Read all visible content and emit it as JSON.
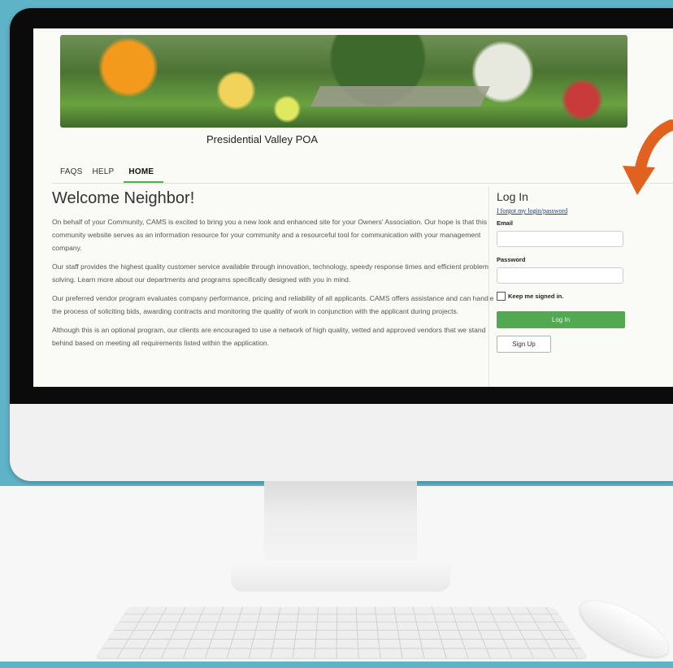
{
  "site": {
    "title": "Presidential Valley POA"
  },
  "nav": {
    "items": [
      "FAQS",
      "HELP",
      "HOME"
    ],
    "active": "HOME"
  },
  "main": {
    "heading": "Welcome Neighbor!",
    "paragraphs": [
      "On behalf of your Community, CAMS is excited to bring you a new look and enhanced site for your Owners' Association. Our hope is that this community website serves as an information resource for your community and a resourceful tool for communication with your management company.",
      "Our staff provides the highest quality customer service available through innovation, technology, speedy response times and efficient problem solving. Learn more about our departments and programs specifically designed with you in mind.",
      "Our preferred vendor program evaluates company performance, pricing and reliability of all applicants. CAMS offers assistance and can handle the process of soliciting bids, awarding contracts and monitoring the quality of work in conjunction with the applicant during projects.",
      "Although this is an optional program, our clients are encouraged to use a network of high quality, vetted and approved vendors that we stand behind based on meeting all requirements listed within the application."
    ]
  },
  "login": {
    "heading": "Log In",
    "forgot_link": "I forgot my login/password",
    "email_label": "Email",
    "email_value": "",
    "password_label": "Password",
    "password_value": "",
    "keep_signed_in": "Keep me signed in.",
    "keep_checked": false,
    "login_button": "Log In",
    "signup_button": "Sign Up"
  },
  "colors": {
    "background": "#5fb3c7",
    "accent_green": "#53a852",
    "arrow": "#e0621e",
    "link": "#1f3e7a"
  },
  "icons": {
    "pointer": "curved-arrow-icon"
  }
}
